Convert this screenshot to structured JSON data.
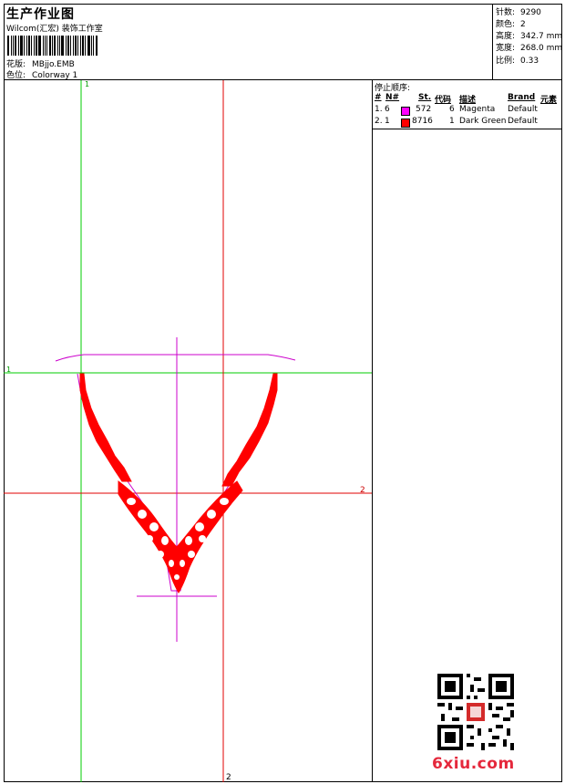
{
  "header": {
    "title": "生产作业图",
    "subtitle": "Wilcom(汇宏) 装饰工作室",
    "design_label": "花版:",
    "design_value": "MBjjo.EMB",
    "colorway_label": "色位:",
    "colorway_value": "Colorway 1"
  },
  "stats": {
    "stitches_label": "针数:",
    "stitches_value": "9290",
    "colors_label": "颜色:",
    "colors_value": "2",
    "height_label": "高度:",
    "height_value": "342.7 mm",
    "width_label": "宽度:",
    "width_value": "268.0 mm",
    "scale_label": "比例:",
    "scale_value": "0.33"
  },
  "canvas": {
    "axis_labels": [
      "1",
      "1",
      "2",
      "2"
    ],
    "guide_colors": {
      "green": "#00cc00",
      "red": "#e00000",
      "magenta": "#cc00cc"
    },
    "fill_color": "#ff0000"
  },
  "stop_sequence": {
    "title": "停止顺序:",
    "columns": [
      "#",
      "N#",
      "St.",
      "代码",
      "描述",
      "Brand",
      "元素"
    ],
    "rows": [
      {
        "seq": "1.",
        "needle": "6",
        "color": "#ff00ff",
        "stitches": "572",
        "code": "6",
        "description": "Magenta",
        "brand": "Default"
      },
      {
        "seq": "2.",
        "needle": "1",
        "color": "#ff0000",
        "stitches": "8716",
        "code": "1",
        "description": "Dark Green",
        "brand": "Default"
      }
    ]
  },
  "watermark": {
    "text": "6xiu.com"
  }
}
